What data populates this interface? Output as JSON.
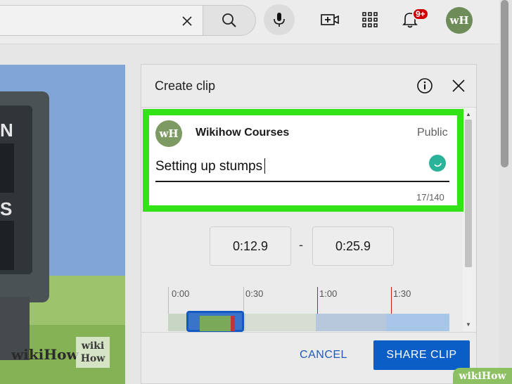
{
  "header": {
    "notifications_count": "9+",
    "avatar_initials": "wH",
    "icons": [
      "clear-icon",
      "search-icon",
      "microphone-icon",
      "create-video-icon",
      "apps-grid-icon",
      "bell-icon"
    ]
  },
  "video": {
    "board_letters": [
      "N",
      "S"
    ],
    "watermark": "wikiHow",
    "watermark_logo_top": "wiki",
    "watermark_logo_bottom": "How"
  },
  "clip_panel": {
    "title": "Create clip",
    "channel_avatar": "wH",
    "channel_name": "Wikihow Courses",
    "visibility": "Public",
    "clip_title_value": "Setting up stumps",
    "char_counter": "17/140",
    "start_time": "0:12.9",
    "time_separator": "-",
    "end_time": "0:25.9",
    "timeline_ticks": [
      "0:00",
      "0:30",
      "1:00",
      "1:30"
    ],
    "cancel_label": "CANCEL",
    "share_label": "SHARE CLIP"
  },
  "corner_badge": "wikiHow",
  "colors": {
    "highlight": "#33e318",
    "primary_blue": "#0b5ec5",
    "badge_red": "#cc0000",
    "wikihow_green": "#8cc063"
  }
}
